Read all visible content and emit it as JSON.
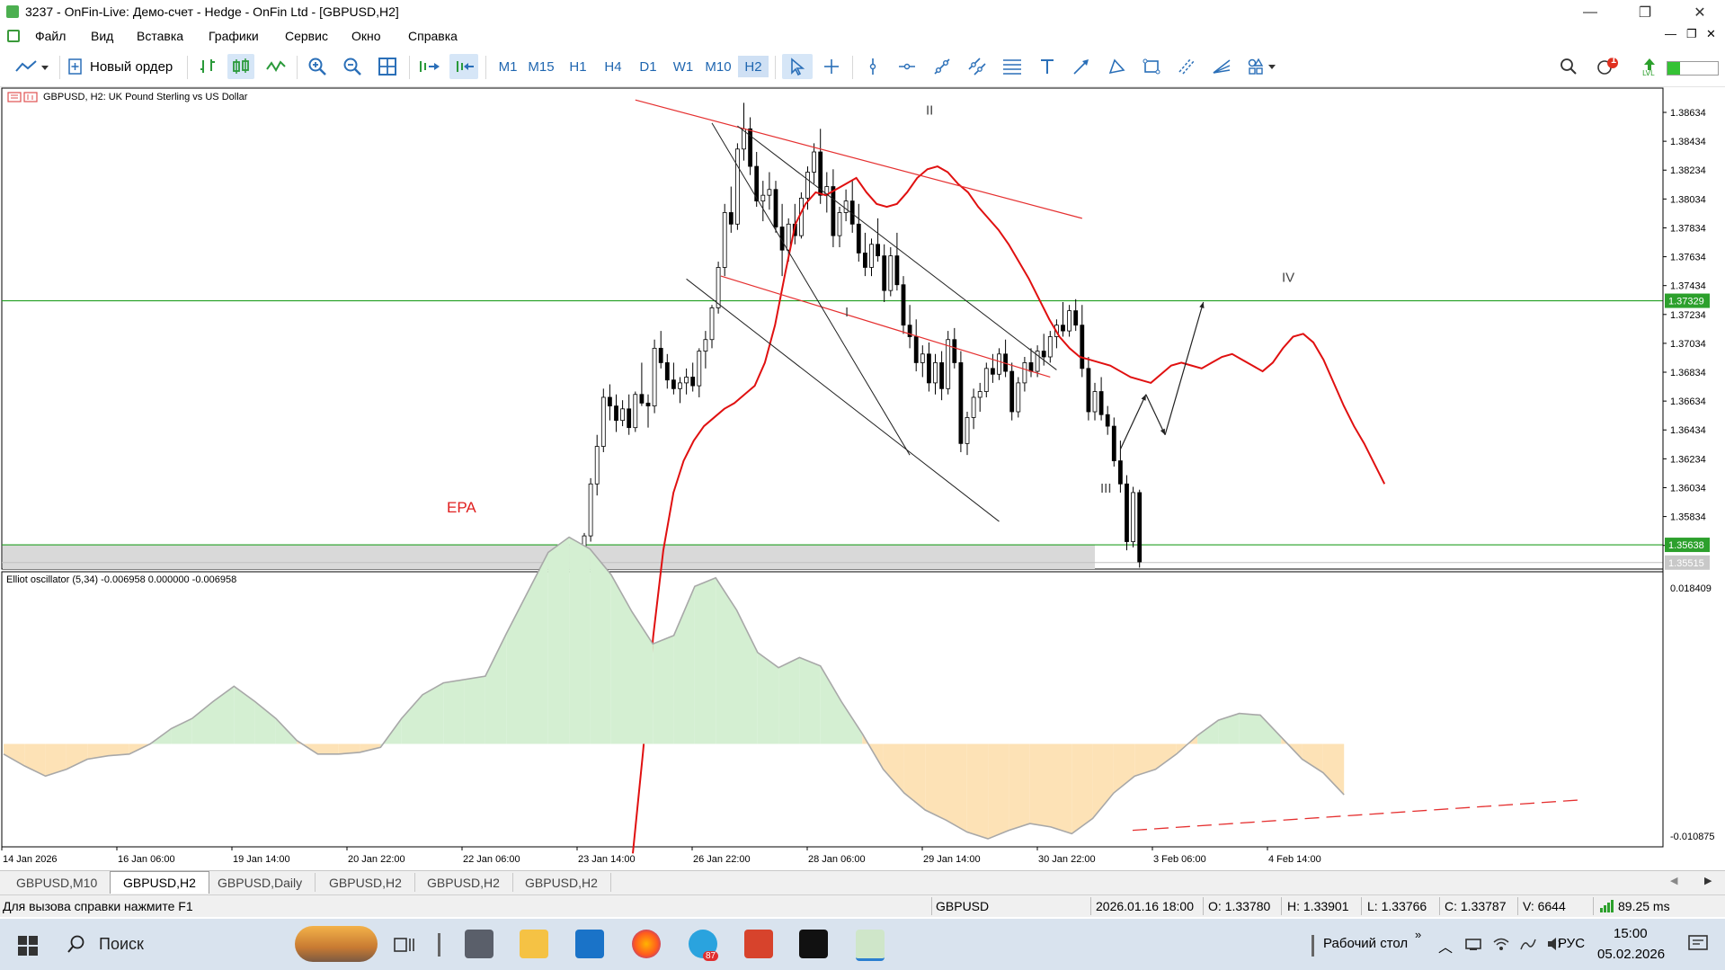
{
  "window": {
    "title": "3237 - OnFin-Live: Демо-счет - Hedge - OnFin Ltd - [GBPUSD,H2]",
    "controls": [
      "—",
      "❐",
      "✕"
    ],
    "mdi_controls": [
      "—",
      "❐",
      "✕"
    ]
  },
  "menu": [
    "Файл",
    "Вид",
    "Вставка",
    "Графики",
    "Сервис",
    "Окно",
    "Справка"
  ],
  "toolbar": {
    "new_order_label": "Новый ордер",
    "timeframes": [
      "M1",
      "M15",
      "H1",
      "H4",
      "D1",
      "W1",
      "M10",
      "H2"
    ],
    "active_timeframe": "H2",
    "notification_count": "1"
  },
  "chart_header": {
    "symbol_line": "GBPUSD, H2:  UK Pound Sterling vs US Dollar"
  },
  "chart_data": [
    {
      "type": "candlestick",
      "symbol": "GBPUSD",
      "timeframe": "H2",
      "description": "UK Pound Sterling vs US Dollar",
      "price_axis_ticks": [
        "1.38634",
        "1.38434",
        "1.38234",
        "1.38034",
        "1.37834",
        "1.37634",
        "1.37434",
        "1.37234",
        "1.37034",
        "1.36834",
        "1.36634",
        "1.36434",
        "1.36234",
        "1.36034",
        "1.35834",
        "1.35634"
      ],
      "price_labels": {
        "green_line_upper": "1.37329",
        "green_line_lower": "1.35638",
        "current_bid": "1.35515"
      },
      "ylim": [
        1.3552,
        1.3874
      ],
      "horizontal_levels": [
        1.37329,
        1.35638
      ],
      "wave_labels": [
        {
          "text": "I",
          "price": 1.3722
        },
        {
          "text": "II",
          "price": 1.3862
        },
        {
          "text": "III",
          "price": 1.36
        },
        {
          "text": "IV",
          "price": 1.3746
        }
      ],
      "annotation": "EPA",
      "time_axis_labels": [
        "14 Jan 2026",
        "16 Jan 06:00",
        "19 Jan 14:00",
        "20 Jan 22:00",
        "22 Jan 06:00",
        "23 Jan 14:00",
        "26 Jan 22:00",
        "28 Jan 06:00",
        "29 Jan 14:00",
        "30 Jan 22:00",
        "3 Feb 06:00",
        "4 Feb 14:00"
      ],
      "candles_ohlc": [
        [
          1.3562,
          1.3572,
          1.3555,
          1.357
        ],
        [
          1.357,
          1.361,
          1.3566,
          1.3606
        ],
        [
          1.3606,
          1.364,
          1.3598,
          1.3632
        ],
        [
          1.3632,
          1.3672,
          1.3628,
          1.3666
        ],
        [
          1.3666,
          1.3675,
          1.365,
          1.366
        ],
        [
          1.366,
          1.3668,
          1.3642,
          1.365
        ],
        [
          1.365,
          1.3664,
          1.3646,
          1.3658
        ],
        [
          1.3658,
          1.3668,
          1.364,
          1.3645
        ],
        [
          1.3645,
          1.367,
          1.3642,
          1.3668
        ],
        [
          1.3668,
          1.369,
          1.366,
          1.3662
        ],
        [
          1.3662,
          1.3668,
          1.3645,
          1.366
        ],
        [
          1.366,
          1.3706,
          1.3655,
          1.37
        ],
        [
          1.37,
          1.3712,
          1.3686,
          1.369
        ],
        [
          1.369,
          1.3696,
          1.3672,
          1.3678
        ],
        [
          1.3678,
          1.369,
          1.3668,
          1.3672
        ],
        [
          1.3672,
          1.368,
          1.3662,
          1.3676
        ],
        [
          1.3676,
          1.3686,
          1.3668,
          1.368
        ],
        [
          1.368,
          1.369,
          1.367,
          1.3674
        ],
        [
          1.3674,
          1.37,
          1.3666,
          1.3698
        ],
        [
          1.3698,
          1.3712,
          1.3686,
          1.3706
        ],
        [
          1.3706,
          1.373,
          1.37,
          1.3728
        ],
        [
          1.3728,
          1.376,
          1.3724,
          1.3756
        ],
        [
          1.3756,
          1.38,
          1.375,
          1.3794
        ],
        [
          1.3794,
          1.3812,
          1.378,
          1.3786
        ],
        [
          1.3786,
          1.3842,
          1.3782,
          1.3838
        ],
        [
          1.3838,
          1.387,
          1.383,
          1.3852
        ],
        [
          1.3852,
          1.386,
          1.382,
          1.3826
        ],
        [
          1.3826,
          1.3836,
          1.3798,
          1.3802
        ],
        [
          1.3802,
          1.3816,
          1.3788,
          1.3806
        ],
        [
          1.3806,
          1.3822,
          1.3796,
          1.381
        ],
        [
          1.381,
          1.3816,
          1.378,
          1.3784
        ],
        [
          1.3784,
          1.38,
          1.375,
          1.3768
        ],
        [
          1.3768,
          1.379,
          1.376,
          1.3786
        ],
        [
          1.3786,
          1.38,
          1.3772,
          1.3778
        ],
        [
          1.3778,
          1.3808,
          1.3776,
          1.3804
        ],
        [
          1.3804,
          1.3826,
          1.3796,
          1.3822
        ],
        [
          1.3822,
          1.3842,
          1.3814,
          1.3836
        ],
        [
          1.3836,
          1.3852,
          1.38,
          1.3806
        ],
        [
          1.3806,
          1.3822,
          1.3794,
          1.3812
        ],
        [
          1.3812,
          1.3824,
          1.377,
          1.3778
        ],
        [
          1.3778,
          1.3798,
          1.377,
          1.3794
        ],
        [
          1.3794,
          1.381,
          1.3788,
          1.3802
        ],
        [
          1.3802,
          1.3816,
          1.378,
          1.3786
        ],
        [
          1.3786,
          1.38,
          1.376,
          1.3766
        ],
        [
          1.3766,
          1.378,
          1.375,
          1.3756
        ],
        [
          1.3756,
          1.3776,
          1.375,
          1.3772
        ],
        [
          1.3772,
          1.379,
          1.376,
          1.3764
        ],
        [
          1.3764,
          1.3772,
          1.3732,
          1.374
        ],
        [
          1.374,
          1.377,
          1.3736,
          1.3764
        ],
        [
          1.3764,
          1.378,
          1.374,
          1.3744
        ],
        [
          1.3744,
          1.375,
          1.371,
          1.3716
        ],
        [
          1.3716,
          1.373,
          1.37,
          1.3708
        ],
        [
          1.3708,
          1.372,
          1.3684,
          1.369
        ],
        [
          1.369,
          1.3702,
          1.368,
          1.3696
        ],
        [
          1.3696,
          1.3704,
          1.367,
          1.3676
        ],
        [
          1.3676,
          1.3696,
          1.3668,
          1.369
        ],
        [
          1.369,
          1.3698,
          1.3664,
          1.3672
        ],
        [
          1.3672,
          1.3712,
          1.3668,
          1.3706
        ],
        [
          1.3706,
          1.3714,
          1.3686,
          1.369
        ],
        [
          1.369,
          1.3698,
          1.3628,
          1.3634
        ],
        [
          1.3634,
          1.3656,
          1.3626,
          1.3652
        ],
        [
          1.3652,
          1.3672,
          1.3644,
          1.3666
        ],
        [
          1.3666,
          1.3676,
          1.3656,
          1.367
        ],
        [
          1.367,
          1.369,
          1.3666,
          1.3686
        ],
        [
          1.3686,
          1.3696,
          1.3676,
          1.3682
        ],
        [
          1.3682,
          1.37,
          1.3678,
          1.3696
        ],
        [
          1.3696,
          1.3706,
          1.368,
          1.3684
        ],
        [
          1.3684,
          1.369,
          1.365,
          1.3656
        ],
        [
          1.3656,
          1.368,
          1.3652,
          1.3676
        ],
        [
          1.3676,
          1.3694,
          1.367,
          1.369
        ],
        [
          1.369,
          1.37,
          1.368,
          1.3684
        ],
        [
          1.3684,
          1.3702,
          1.368,
          1.3698
        ],
        [
          1.3698,
          1.371,
          1.3688,
          1.3694
        ],
        [
          1.3694,
          1.3712,
          1.369,
          1.3708
        ],
        [
          1.3708,
          1.372,
          1.37,
          1.3716
        ],
        [
          1.3716,
          1.3732,
          1.3708,
          1.3712
        ],
        [
          1.3712,
          1.373,
          1.3708,
          1.3726
        ],
        [
          1.3726,
          1.3734,
          1.3712,
          1.3716
        ],
        [
          1.3716,
          1.373,
          1.368,
          1.3686
        ],
        [
          1.3686,
          1.3694,
          1.365,
          1.3656
        ],
        [
          1.3656,
          1.3676,
          1.365,
          1.367
        ],
        [
          1.367,
          1.368,
          1.365,
          1.3654
        ],
        [
          1.3654,
          1.366,
          1.364,
          1.3646
        ],
        [
          1.3646,
          1.3652,
          1.3618,
          1.3622
        ],
        [
          1.3622,
          1.3636,
          1.36,
          1.3606
        ],
        [
          1.3606,
          1.3612,
          1.356,
          1.3566
        ],
        [
          1.3566,
          1.3604,
          1.3562,
          1.36
        ],
        [
          1.36,
          1.3602,
          1.3548,
          1.3552
        ]
      ],
      "moving_average": [
        1.335,
        1.342,
        1.35,
        1.356,
        1.36,
        1.3622,
        1.3636,
        1.3646,
        1.3652,
        1.3658,
        1.3662,
        1.3668,
        1.3674,
        1.369,
        1.3716,
        1.3752,
        1.3786,
        1.38,
        1.3808,
        1.3806,
        1.381,
        1.3814,
        1.3818,
        1.3808,
        1.38,
        1.3798,
        1.38,
        1.3808,
        1.3818,
        1.3824,
        1.3826,
        1.3822,
        1.3814,
        1.3808,
        1.3798,
        1.379,
        1.3782,
        1.3772,
        1.376,
        1.3748,
        1.3734,
        1.372,
        1.3708,
        1.37,
        1.3694,
        1.3692,
        1.369,
        1.3688,
        1.3684,
        1.368,
        1.3678,
        1.3676,
        1.3682,
        1.3688,
        1.369,
        1.3688,
        1.3686,
        1.369,
        1.3694,
        1.3696,
        1.3692,
        1.3688,
        1.3684,
        1.369,
        1.37,
        1.3708,
        1.371,
        1.3704,
        1.3692,
        1.3676,
        1.366,
        1.3646,
        1.3634,
        1.362,
        1.3606
      ]
    },
    {
      "type": "area",
      "title": "Elliot oscillator (5,34) -0.006958 0.000000 -0.006958",
      "y_axis_ticks": [
        "0.018409",
        "-0.010875"
      ],
      "ylim": [
        -0.010875,
        0.018409
      ],
      "values": [
        -0.0012,
        -0.0026,
        -0.0038,
        -0.003,
        -0.0018,
        -0.0014,
        -0.0012,
        0.0,
        0.0018,
        0.003,
        0.005,
        0.0068,
        0.005,
        0.003,
        0.0004,
        -0.0012,
        -0.0012,
        -0.001,
        -0.0004,
        0.003,
        0.0058,
        0.0072,
        0.0076,
        0.008,
        0.013,
        0.0178,
        0.0226,
        0.0244,
        0.023,
        0.02,
        0.0156,
        0.0118,
        0.0128,
        0.0186,
        0.0196,
        0.0158,
        0.0108,
        0.009,
        0.0102,
        0.0092,
        0.005,
        0.0012,
        -0.003,
        -0.0058,
        -0.0078,
        -0.009,
        -0.0104,
        -0.0112,
        -0.0102,
        -0.0094,
        -0.0098,
        -0.0106,
        -0.0088,
        -0.0058,
        -0.0038,
        -0.003,
        -0.0012,
        0.001,
        0.0028,
        0.0036,
        0.0034,
        0.0008,
        -0.0018,
        -0.0034,
        -0.006
      ],
      "positive_fill": "#d4efd2",
      "negative_fill": "#fde2b6"
    }
  ],
  "bottom_tabs": [
    "GBPUSD,M10",
    "GBPUSD,H2",
    "GBPUSD,Daily",
    "GBPUSD,H2",
    "GBPUSD,H2",
    "GBPUSD,H2"
  ],
  "active_tab_index": 1,
  "status": {
    "help": "Для вызова справки нажмите F1",
    "symbol": "GBPUSD",
    "datetime": "2026.01.16 18:00",
    "open": "O: 1.33780",
    "high": "H: 1.33901",
    "low": "L: 1.33766",
    "close": "C: 1.33787",
    "volume": "V: 6644",
    "ping": "89.25 ms"
  },
  "taskbar": {
    "search_placeholder": "Поиск",
    "desktop_label": "Рабочий стол",
    "language": "РУС",
    "time": "15:00",
    "date": "05.02.2026",
    "telegram_badge": "87"
  },
  "colors": {
    "bull_candle": "#ffffff",
    "bear_candle": "#000000",
    "ma_line": "#e01010",
    "level_line": "#23a023",
    "channel_red": "#e53030",
    "channel_black": "#222222",
    "annotation_red": "#e02020",
    "price_label_green": "#2ca02c"
  }
}
